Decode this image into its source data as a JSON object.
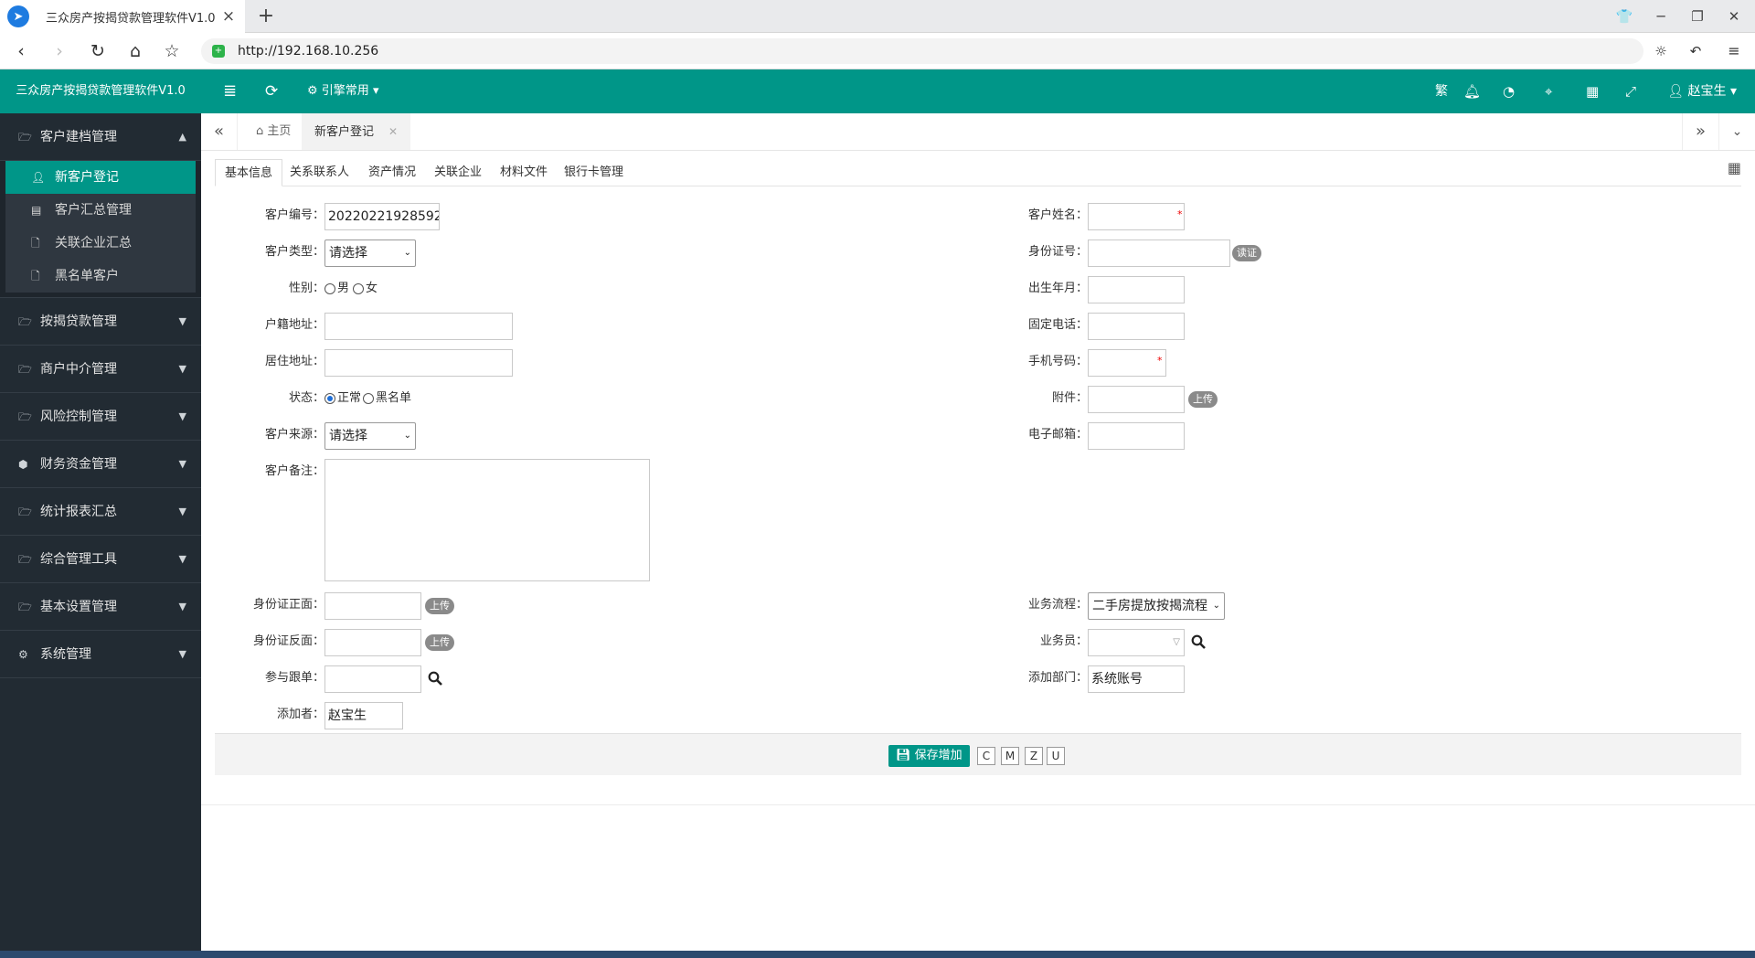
{
  "browser": {
    "tab_title": "三众房产按揭贷款管理软件V1.0",
    "url": "http://192.168.10.256"
  },
  "header": {
    "app_name": "三众房产按揭贷款管理软件V1.0",
    "engine": "引擎常用",
    "user": "赵宝生",
    "accent_color": "#009688"
  },
  "sidebar": {
    "groups": [
      {
        "label": "客户建档管理",
        "expanded": true,
        "items": [
          {
            "label": "新客户登记",
            "active": true
          },
          {
            "label": "客户汇总管理"
          },
          {
            "label": "关联企业汇总"
          },
          {
            "label": "黑名单客户"
          }
        ]
      },
      {
        "label": "按揭贷款管理"
      },
      {
        "label": "商户中介管理"
      },
      {
        "label": "风险控制管理"
      },
      {
        "label": "财务资金管理"
      },
      {
        "label": "统计报表汇总"
      },
      {
        "label": "综合管理工具"
      },
      {
        "label": "基本设置管理"
      },
      {
        "label": "系统管理"
      }
    ]
  },
  "page_tabs": {
    "home": "主页",
    "current": "新客户登记"
  },
  "form_tabs": [
    "基本信息",
    "关系联系人",
    "资产情况",
    "关联企业",
    "材料文件",
    "银行卡管理"
  ],
  "form": {
    "customer_no_label": "客户编号：",
    "customer_no": "20220221928592",
    "customer_type_label": "客户类型：",
    "customer_type": "请选择",
    "gender_label": "性别：",
    "gender_male": "男",
    "gender_female": "女",
    "hukou_label": "户籍地址：",
    "residence_label": "居住地址：",
    "status_label": "状态：",
    "status_normal": "正常",
    "status_black": "黑名单",
    "source_label": "客户来源：",
    "source": "请选择",
    "remark_label": "客户备注：",
    "name_label": "客户姓名：",
    "id_label": "身份证号：",
    "id_read": "读证",
    "birth_label": "出生年月：",
    "phone_label": "固定电话：",
    "mobile_label": "手机号码：",
    "attach_label": "附件：",
    "upload": "上传",
    "email_label": "电子邮箱：",
    "id_front_label": "身份证正面：",
    "id_back_label": "身份证反面：",
    "follow_label": "参与跟单：",
    "adder_label": "添加者：",
    "adder": "赵宝生",
    "flow_label": "业务流程：",
    "flow": "二手房提放按揭流程",
    "staff_label": "业务员：",
    "dept_label": "添加部门：",
    "dept": "系统账号"
  },
  "actions": {
    "save": "保存增加",
    "keys": [
      "C",
      "M",
      "Z",
      "U"
    ]
  }
}
